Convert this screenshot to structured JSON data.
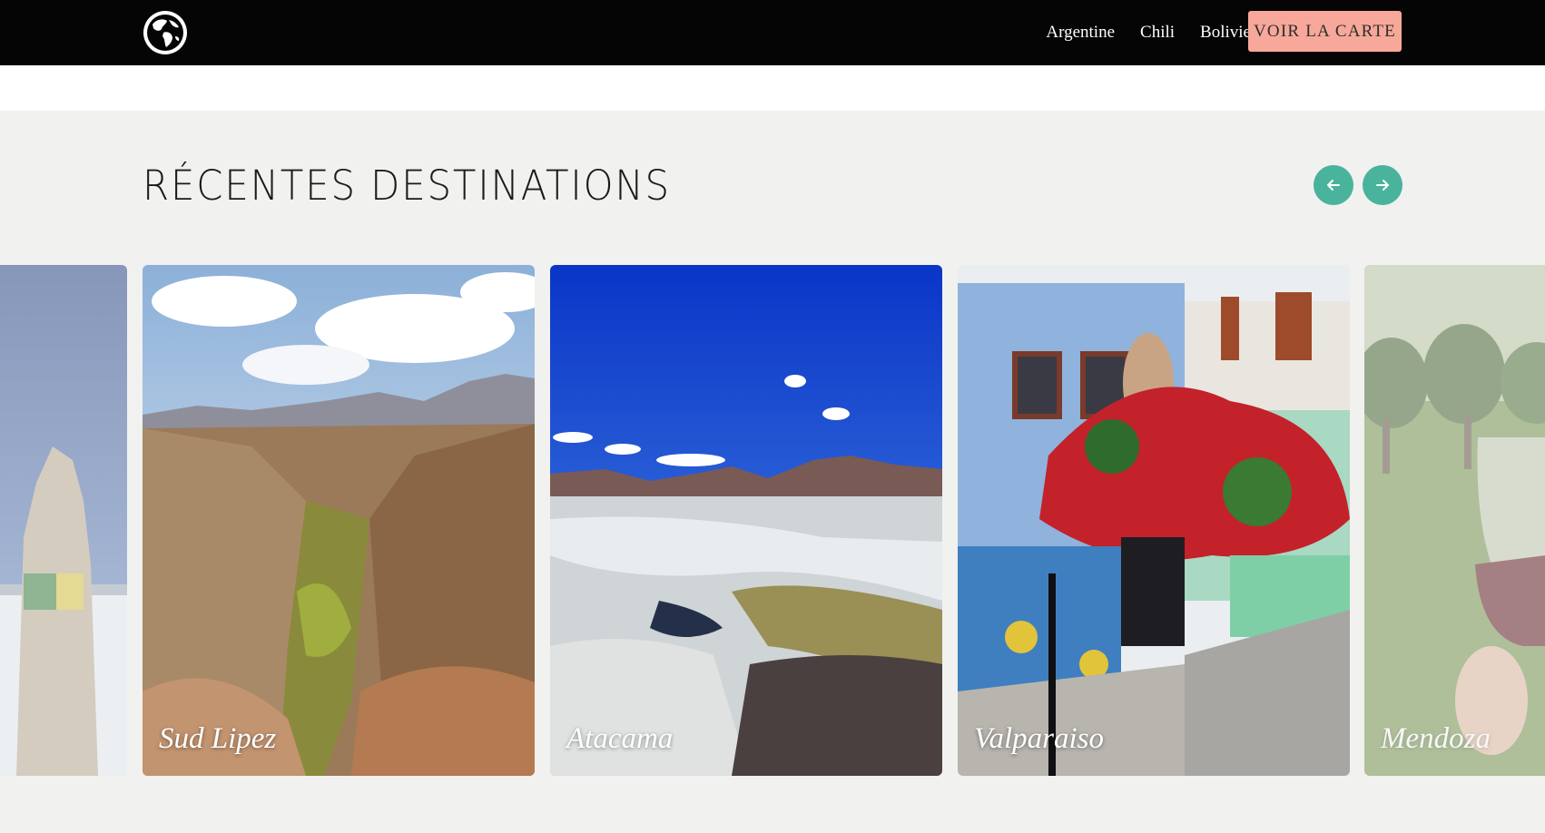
{
  "nav": {
    "logo": "globe-icon",
    "links": [
      "Argentine",
      "Chili",
      "Bolivie"
    ],
    "map_button": "VOIR LA CARTE"
  },
  "section": {
    "title": "RÉCENTES DESTINATIONS",
    "prev": "arrow-left-icon",
    "next": "arrow-right-icon"
  },
  "destinations": [
    {
      "name": "",
      "state": "partially visible"
    },
    {
      "name": "Sud Lipez"
    },
    {
      "name": "Atacama"
    },
    {
      "name": "Valparaiso"
    },
    {
      "name": "Mendoza",
      "state": "partially visible"
    }
  ],
  "colors": {
    "navbar": "#050505",
    "map_button": "#f7a89a",
    "arrows": "#49b39b",
    "section_bg": "#f1f1ef"
  }
}
